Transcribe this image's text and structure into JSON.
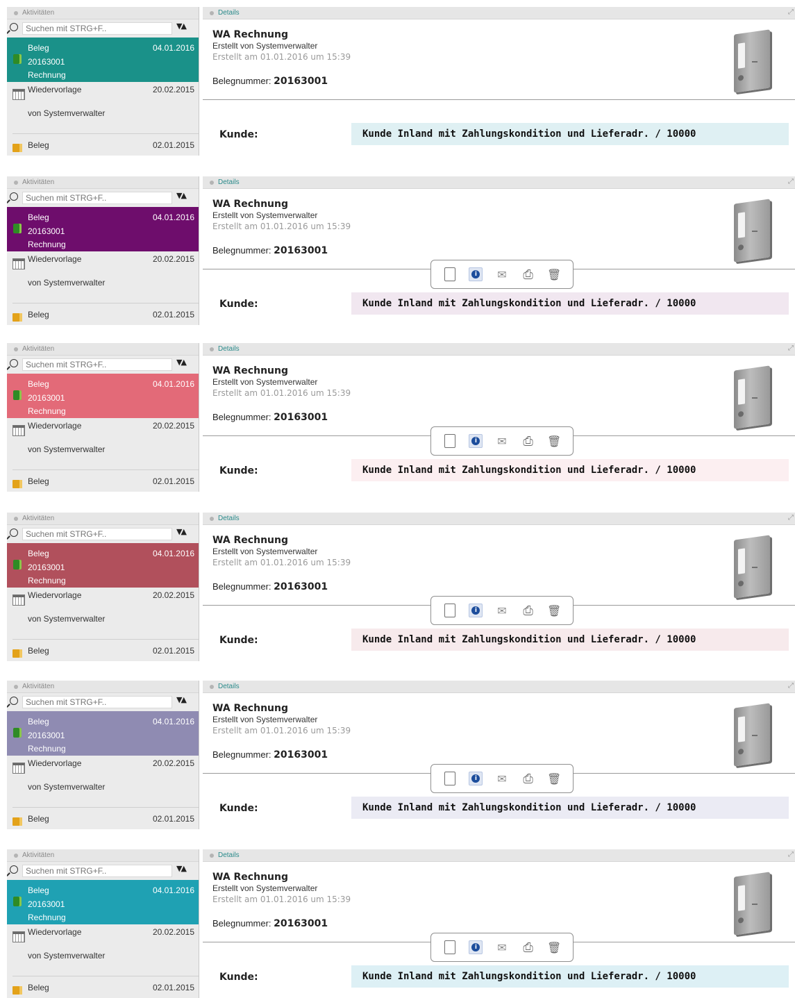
{
  "left_panel": {
    "title": "Aktivitäten",
    "search_placeholder": "Suchen mit STRG+F..",
    "sort_glyph": "▼▲",
    "selected_item": {
      "type": "Beleg",
      "date": "04.01.2016",
      "number": "20163001",
      "kind": "Rechnung"
    },
    "wiedervorlage": {
      "label": "Wiedervorlage",
      "date": "20.02.2015",
      "by": "von Systemverwalter"
    },
    "beleg2": {
      "label": "Beleg",
      "date": "02.01.2015"
    }
  },
  "right_panel": {
    "title": "Details",
    "doc_title": "WA Rechnung",
    "created_by": "Erstellt von Systemverwalter",
    "created_at": "Erstellt am 01.01.2016 um 15:39",
    "belegnummer_label": "Belegnummer: ",
    "belegnummer_value": "20163001",
    "kunde_label": "Kunde:",
    "kunde_value": "Kunde Inland mit Zahlungskondition und Lieferadr. / 10000"
  },
  "variants": [
    {
      "accent": "#1a9189",
      "kunde_bg": "#dff0f3",
      "toolbar": false
    },
    {
      "accent": "#6e0d6c",
      "kunde_bg": "#f1e7f0",
      "toolbar": true
    },
    {
      "accent": "#e36a78",
      "kunde_bg": "#fceff1",
      "toolbar": true
    },
    {
      "accent": "#b1505c",
      "kunde_bg": "#f7eaec",
      "toolbar": true
    },
    {
      "accent": "#8f8bb2",
      "kunde_bg": "#ebebf4",
      "toolbar": true
    },
    {
      "accent": "#1fa1b3",
      "kunde_bg": "#ddf0f5",
      "toolbar": true
    }
  ]
}
